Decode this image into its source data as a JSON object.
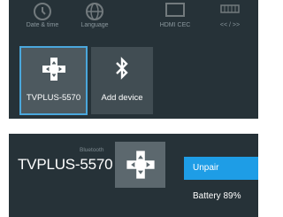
{
  "settings_grid": {
    "previous_row": [
      {
        "label": "Date & time",
        "icon": "clock-icon"
      },
      {
        "label": "Language",
        "icon": "globe-icon"
      },
      {
        "label": "HDMI CEC",
        "icon": "hdmi-icon"
      },
      {
        "label": "<< / >>",
        "icon": "keyboard-icon"
      }
    ],
    "tiles": [
      {
        "label": "TVPLUS-5570",
        "icon": "gamepad-icon",
        "focused": true
      },
      {
        "label": "Add device",
        "icon": "bluetooth-icon",
        "focused": false
      }
    ]
  },
  "device_detail": {
    "section_label": "Bluetooth",
    "device_name": "TVPLUS-5570",
    "icon": "gamepad-icon",
    "menu": [
      {
        "label": "Unpair",
        "active": true
      },
      {
        "label": "Battery 89%",
        "active": false
      }
    ]
  },
  "colors": {
    "panel_bg": "#263238",
    "tile_bg": "#414d53",
    "focus_outline": "#4aa7dc",
    "menu_active": "#1e9de6",
    "text": "#ffffff",
    "muted_text": "#8a979d"
  }
}
